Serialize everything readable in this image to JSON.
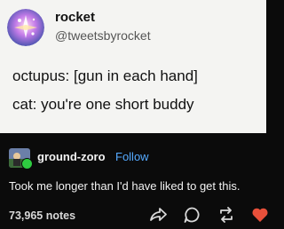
{
  "tweet": {
    "display_name": "rocket",
    "handle": "@tweetsbyrocket",
    "lines": [
      "octupus: [gun in each hand]",
      "cat: you're one short buddy"
    ]
  },
  "reblog": {
    "username": "ground-zoro",
    "follow_label": "Follow",
    "caption": "Took me longer than I'd have liked to get this.",
    "notes": "73,965 notes"
  },
  "actions": [
    "share-icon",
    "reply-icon",
    "reblog-icon",
    "like-icon"
  ],
  "colors": {
    "follow": "#55aaff",
    "badge": "#2ecc40",
    "heart": "#e8503a",
    "tweet_bg": "#f4f4f2",
    "post_bg": "#0b0b0b"
  }
}
